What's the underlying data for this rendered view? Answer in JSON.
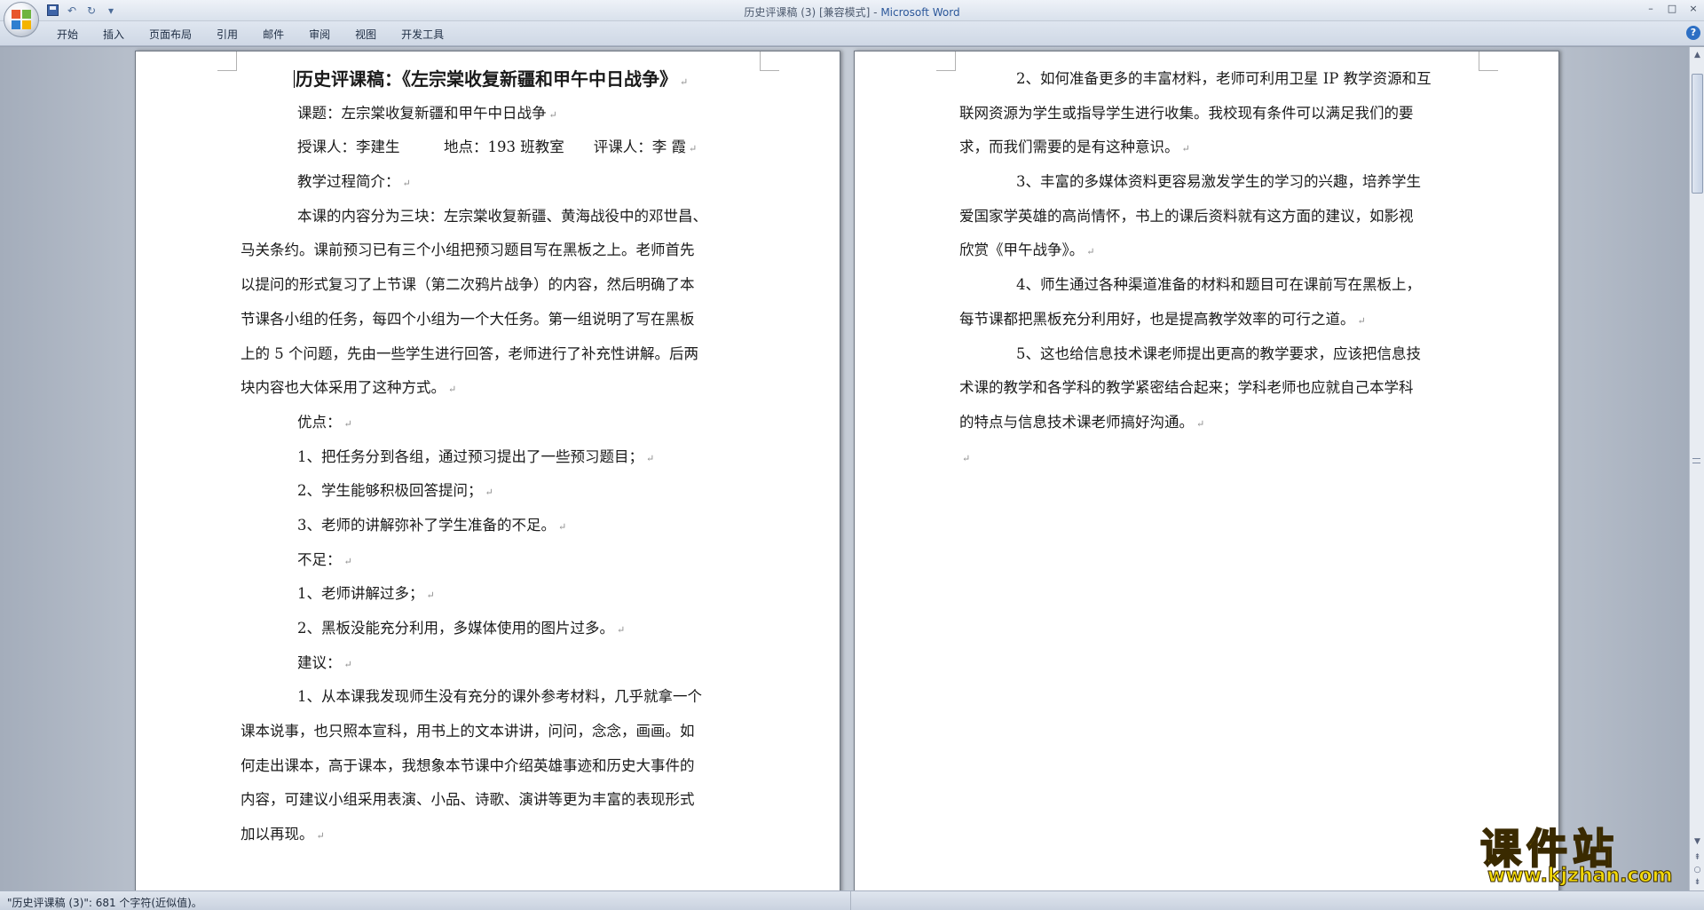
{
  "window": {
    "title": "历史评课稿 (3) [兼容模式] - ",
    "app_name": "Microsoft Word",
    "controls": [
      "–",
      "□",
      "×"
    ]
  },
  "ribbon": {
    "tabs": [
      "开始",
      "插入",
      "页面布局",
      "引用",
      "邮件",
      "审阅",
      "视图",
      "开发工具"
    ],
    "help": "?"
  },
  "quick_access": {
    "save_icon": "save-icon",
    "undo": "↶",
    "redo": "↻",
    "customize": "▾"
  },
  "left_page": {
    "title": "历史评课稿：《左宗棠收复新疆和甲午中日战争》",
    "lines": [
      {
        "text": "课题：左宗棠收复新疆和甲午中日战争",
        "indent": true
      },
      {
        "text": "授课人：李建生　　　地点：193 班教室　　评课人：李 霞",
        "indent": true
      },
      {
        "text": "教学过程简介：",
        "indent": true
      },
      {
        "text": "本课的内容分为三块：左宗棠收复新疆、黄海战役中的邓世昌、",
        "indent": true,
        "cont": true
      },
      {
        "text": "马关条约。课前预习已有三个小组把预习题目写在黑板之上。老师首先",
        "indent": false,
        "cont": true
      },
      {
        "text": "以提问的形式复习了上节课（第二次鸦片战争）的内容，然后明确了本",
        "indent": false,
        "cont": true
      },
      {
        "text": "节课各小组的任务，每四个小组为一个大任务。第一组说明了写在黑板",
        "indent": false,
        "cont": true
      },
      {
        "text": "上的 5 个问题，先由一些学生进行回答，老师进行了补充性讲解。后两",
        "indent": false,
        "cont": true
      },
      {
        "text": "块内容也大体采用了这种方式。",
        "indent": false
      },
      {
        "text": "优点：",
        "indent": true
      },
      {
        "text": "1、把任务分到各组，通过预习提出了一些预习题目；",
        "indent": true
      },
      {
        "text": "2、学生能够积极回答提问；",
        "indent": true
      },
      {
        "text": "3、老师的讲解弥补了学生准备的不足。",
        "indent": true
      },
      {
        "text": "不足：",
        "indent": true
      },
      {
        "text": "1、老师讲解过多；",
        "indent": true
      },
      {
        "text": "2、黑板没能充分利用，多媒体使用的图片过多。",
        "indent": true
      },
      {
        "text": "建议：",
        "indent": true
      },
      {
        "text": "1、从本课我发现师生没有充分的课外参考材料，几乎就拿一个",
        "indent": true,
        "cont": true
      },
      {
        "text": "课本说事，也只照本宣科，用书上的文本讲讲，问问，念念，画画。如",
        "indent": false,
        "cont": true
      },
      {
        "text": "何走出课本，高于课本，我想象本节课中介绍英雄事迹和历史大事件的",
        "indent": false,
        "cont": true
      },
      {
        "text": "内容，可建议小组采用表演、小品、诗歌、演讲等更为丰富的表现形式",
        "indent": false,
        "cont": true
      },
      {
        "text": "加以再现。",
        "indent": false
      }
    ]
  },
  "right_page": {
    "lines": [
      {
        "text": "2、如何准备更多的丰富材料，老师可利用卫星 IP 教学资源和互",
        "indent": true,
        "cont": true
      },
      {
        "text": "联网资源为学生或指导学生进行收集。我校现有条件可以满足我们的要",
        "indent": false,
        "cont": true
      },
      {
        "text": "求，而我们需要的是有这种意识。",
        "indent": false
      },
      {
        "text": "3、丰富的多媒体资料更容易激发学生的学习的兴趣，培养学生",
        "indent": true,
        "cont": true
      },
      {
        "text": "爱国家学英雄的高尚情怀，书上的课后资料就有这方面的建议，如影视",
        "indent": false,
        "cont": true
      },
      {
        "text": "欣赏《甲午战争》。",
        "indent": false
      },
      {
        "text": "4、师生通过各种渠道准备的材料和题目可在课前写在黑板上，",
        "indent": true,
        "cont": true
      },
      {
        "text": "每节课都把黑板充分利用好，也是提高教学效率的可行之道。",
        "indent": false
      },
      {
        "text": "5、这也给信息技术课老师提出更高的教学要求，应该把信息技",
        "indent": true,
        "cont": true
      },
      {
        "text": "术课的教学和各学科的教学紧密结合起来；学科老师也应就自己本学科",
        "indent": false,
        "cont": true
      },
      {
        "text": "的特点与信息技术课老师搞好沟通。",
        "indent": false
      },
      {
        "text": "",
        "indent": false
      }
    ]
  },
  "pilcrow": "↵",
  "status": {
    "text": "\"历史评课稿 (3)\": 681 个字符(近似值)。"
  },
  "watermark": {
    "main": "课件站",
    "url": "www.kjzhan.com"
  },
  "colors": {
    "app_accent": "#2b579a",
    "watermark": "#f2d90a"
  }
}
